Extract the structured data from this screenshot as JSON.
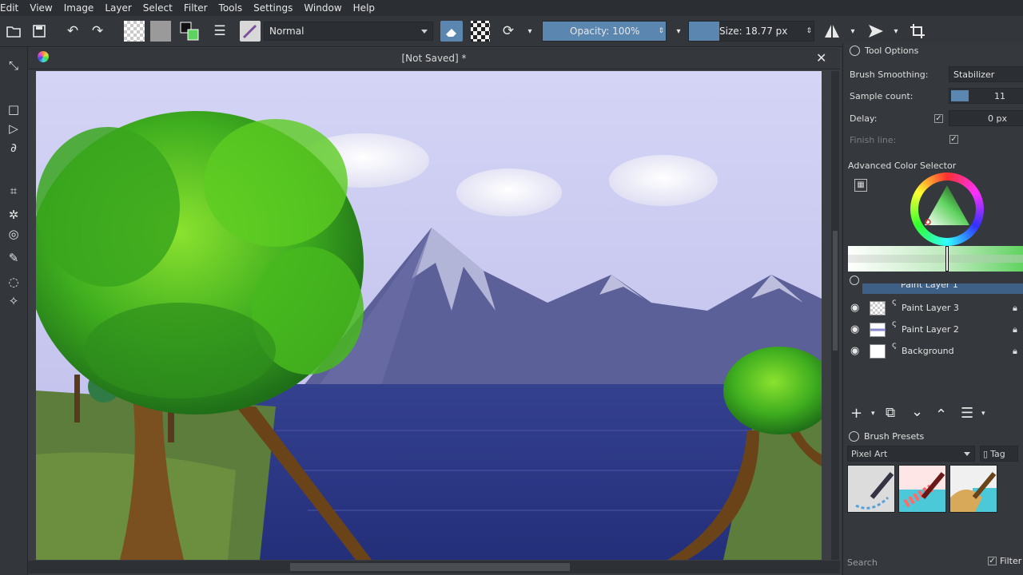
{
  "menu": [
    "Edit",
    "View",
    "Image",
    "Layer",
    "Select",
    "Filter",
    "Tools",
    "Settings",
    "Window",
    "Help"
  ],
  "toolbar": {
    "blend_mode": "Normal",
    "opacity_label": "Opacity: 100%",
    "opacity_fraction": 1.0,
    "size_label": "Size: 18.77 px"
  },
  "document": {
    "title": "[Not Saved]  *"
  },
  "tool_options": {
    "title": "Tool Options",
    "brush_smoothing_label": "Brush Smoothing:",
    "brush_smoothing_value": "Stabilizer",
    "sample_count_label": "Sample count:",
    "sample_count_value": "11",
    "delay_label": "Delay:",
    "delay_checked": true,
    "delay_value": "0 px",
    "finish_line_label": "Finish line:",
    "finish_line_checked": true
  },
  "color_selector": {
    "title": "Advanced Color Selector",
    "accent": "#5fd35f"
  },
  "layers": [
    {
      "name": "Paint Layer 1",
      "partial": true
    },
    {
      "name": "Paint Layer 3"
    },
    {
      "name": "Paint Layer 2"
    },
    {
      "name": "Background"
    }
  ],
  "brush_presets": {
    "title": "Brush Presets",
    "filter": "Pixel Art",
    "tag_label": "Tag",
    "search_placeholder": "Search",
    "filter_check_label": "Filter"
  },
  "colors": {
    "accent": "#5b86b0",
    "panel": "#35383c",
    "sky": "#c9c9ee",
    "water": "#2e3a8a"
  }
}
